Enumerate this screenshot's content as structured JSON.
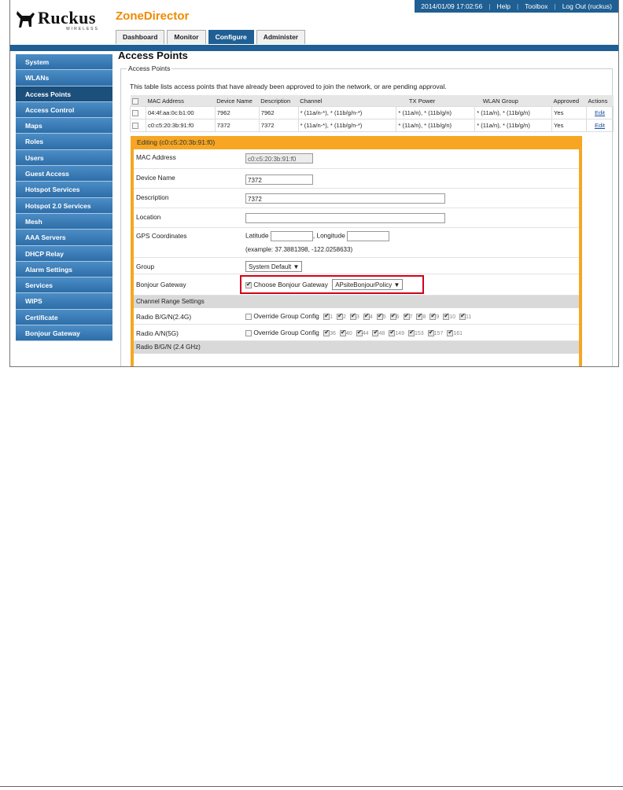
{
  "header": {
    "logo_text": "Ruckus",
    "logo_sub": "WIRELESS",
    "product": "ZoneDirector",
    "datetime": "2014/01/09  17:02:56",
    "help": "Help",
    "toolbox": "Toolbox",
    "logout": "Log Out (ruckus)"
  },
  "tabs": [
    "Dashboard",
    "Monitor",
    "Configure",
    "Administer"
  ],
  "sidebar": [
    "System",
    "WLANs",
    "Access Points",
    "Access Control",
    "Maps",
    "Roles",
    "Users",
    "Guest Access",
    "Hotspot Services",
    "Hotspot 2.0 Services",
    "Mesh",
    "AAA Servers",
    "DHCP Relay",
    "Alarm Settings",
    "Services",
    "WIPS",
    "Certificate",
    "Bonjour Gateway"
  ],
  "page": {
    "title": "Access Points",
    "legend": "Access Points",
    "intro": "This table lists access points that have already been approved to join the network, or are pending approval."
  },
  "table": {
    "headers": [
      "MAC Address",
      "Device Name",
      "Description",
      "Channel",
      "TX Power",
      "WLAN Group",
      "Approved",
      "Actions"
    ],
    "rows": [
      {
        "mac": "04:4f:aa:0c:b1:00",
        "name": "7962",
        "desc": "7962",
        "channel": "* (11a/n-*), * (11b/g/n-*)",
        "tx": "* (11a/n), * (11b/g/n)",
        "wlan": "* (11a/n), * (11b/g/n)",
        "approved": "Yes",
        "action": "Edit"
      },
      {
        "mac": "c0:c5:20:3b:91:f0",
        "name": "7372",
        "desc": "7372",
        "channel": "* (11a/n-*), * (11b/g/n-*)",
        "tx": "* (11a/n), * (11b/g/n)",
        "wlan": "* (11a/n), * (11b/g/n)",
        "approved": "Yes",
        "action": "Edit"
      }
    ]
  },
  "edit": {
    "title": "Editing (c0:c5:20:3b:91:f0)",
    "mac_label": "MAC Address",
    "mac_value": "c0:c5:20:3b:91:f0",
    "name_label": "Device Name",
    "name_value": "7372",
    "desc_label": "Description",
    "desc_value": "7372",
    "location_label": "Location",
    "location_value": "",
    "gps_label": "GPS Coordinates",
    "lat_label": "Latitude",
    "lon_label": ", Longitude",
    "gps_example": "(example: 37.3881398, -122.0258633)",
    "group_label": "Group",
    "group_value": "System Default",
    "bonjour_label": "Bonjour Gateway",
    "bonjour_check_label": "Choose Bonjour Gateway",
    "bonjour_policy": "APsiteBonjourPolicy",
    "channel_section": "Channel Range Settings",
    "radio_bg_label": "Radio B/G/N(2.4G)",
    "radio_an_label": "Radio A/N(5G)",
    "override_label": "Override Group Config",
    "channels_bg": [
      "1",
      "2",
      "3",
      "4",
      "5",
      "6",
      "7",
      "8",
      "9",
      "10",
      "11"
    ],
    "channels_an": [
      "36",
      "40",
      "44",
      "48",
      "149",
      "153",
      "157",
      "161"
    ],
    "radio_section": "Radio B/G/N (2.4 GHz)"
  }
}
